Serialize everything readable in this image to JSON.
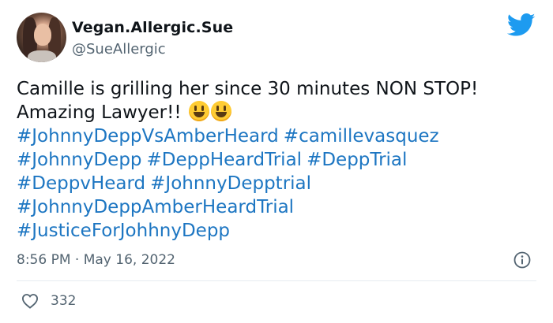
{
  "user": {
    "display_name": "Vegan.Allergic.Sue",
    "handle": "@SueAllergic"
  },
  "tweet": {
    "text_line1": "Camille is grilling her since 30 minutes NON STOP!",
    "text_line2": "Amazing Lawyer!!",
    "hashtag_rows": [
      [
        "#JohnnyDeppVsAmberHeard",
        "#camillevasquez"
      ],
      [
        "#JohnnyDepp",
        "#DeppHeardTrial",
        "#DeppTrial"
      ],
      [
        "#DeppvHeard",
        "#JohnnyDepptrial"
      ],
      [
        "#JohnnyDeppAmberHeardTrial"
      ],
      [
        "#JusticeForJohhnyDepp"
      ]
    ],
    "timestamp": "8:56 PM · May 16, 2022",
    "like_count": "332"
  },
  "icons": {
    "brand": "twitter-bird-icon",
    "info": "info-icon",
    "like": "heart-icon",
    "emoji": "grinning-face-emoji"
  },
  "colors": {
    "link": "#1d76c2",
    "twitter_blue": "#1d9bf0",
    "muted": "#536471"
  }
}
